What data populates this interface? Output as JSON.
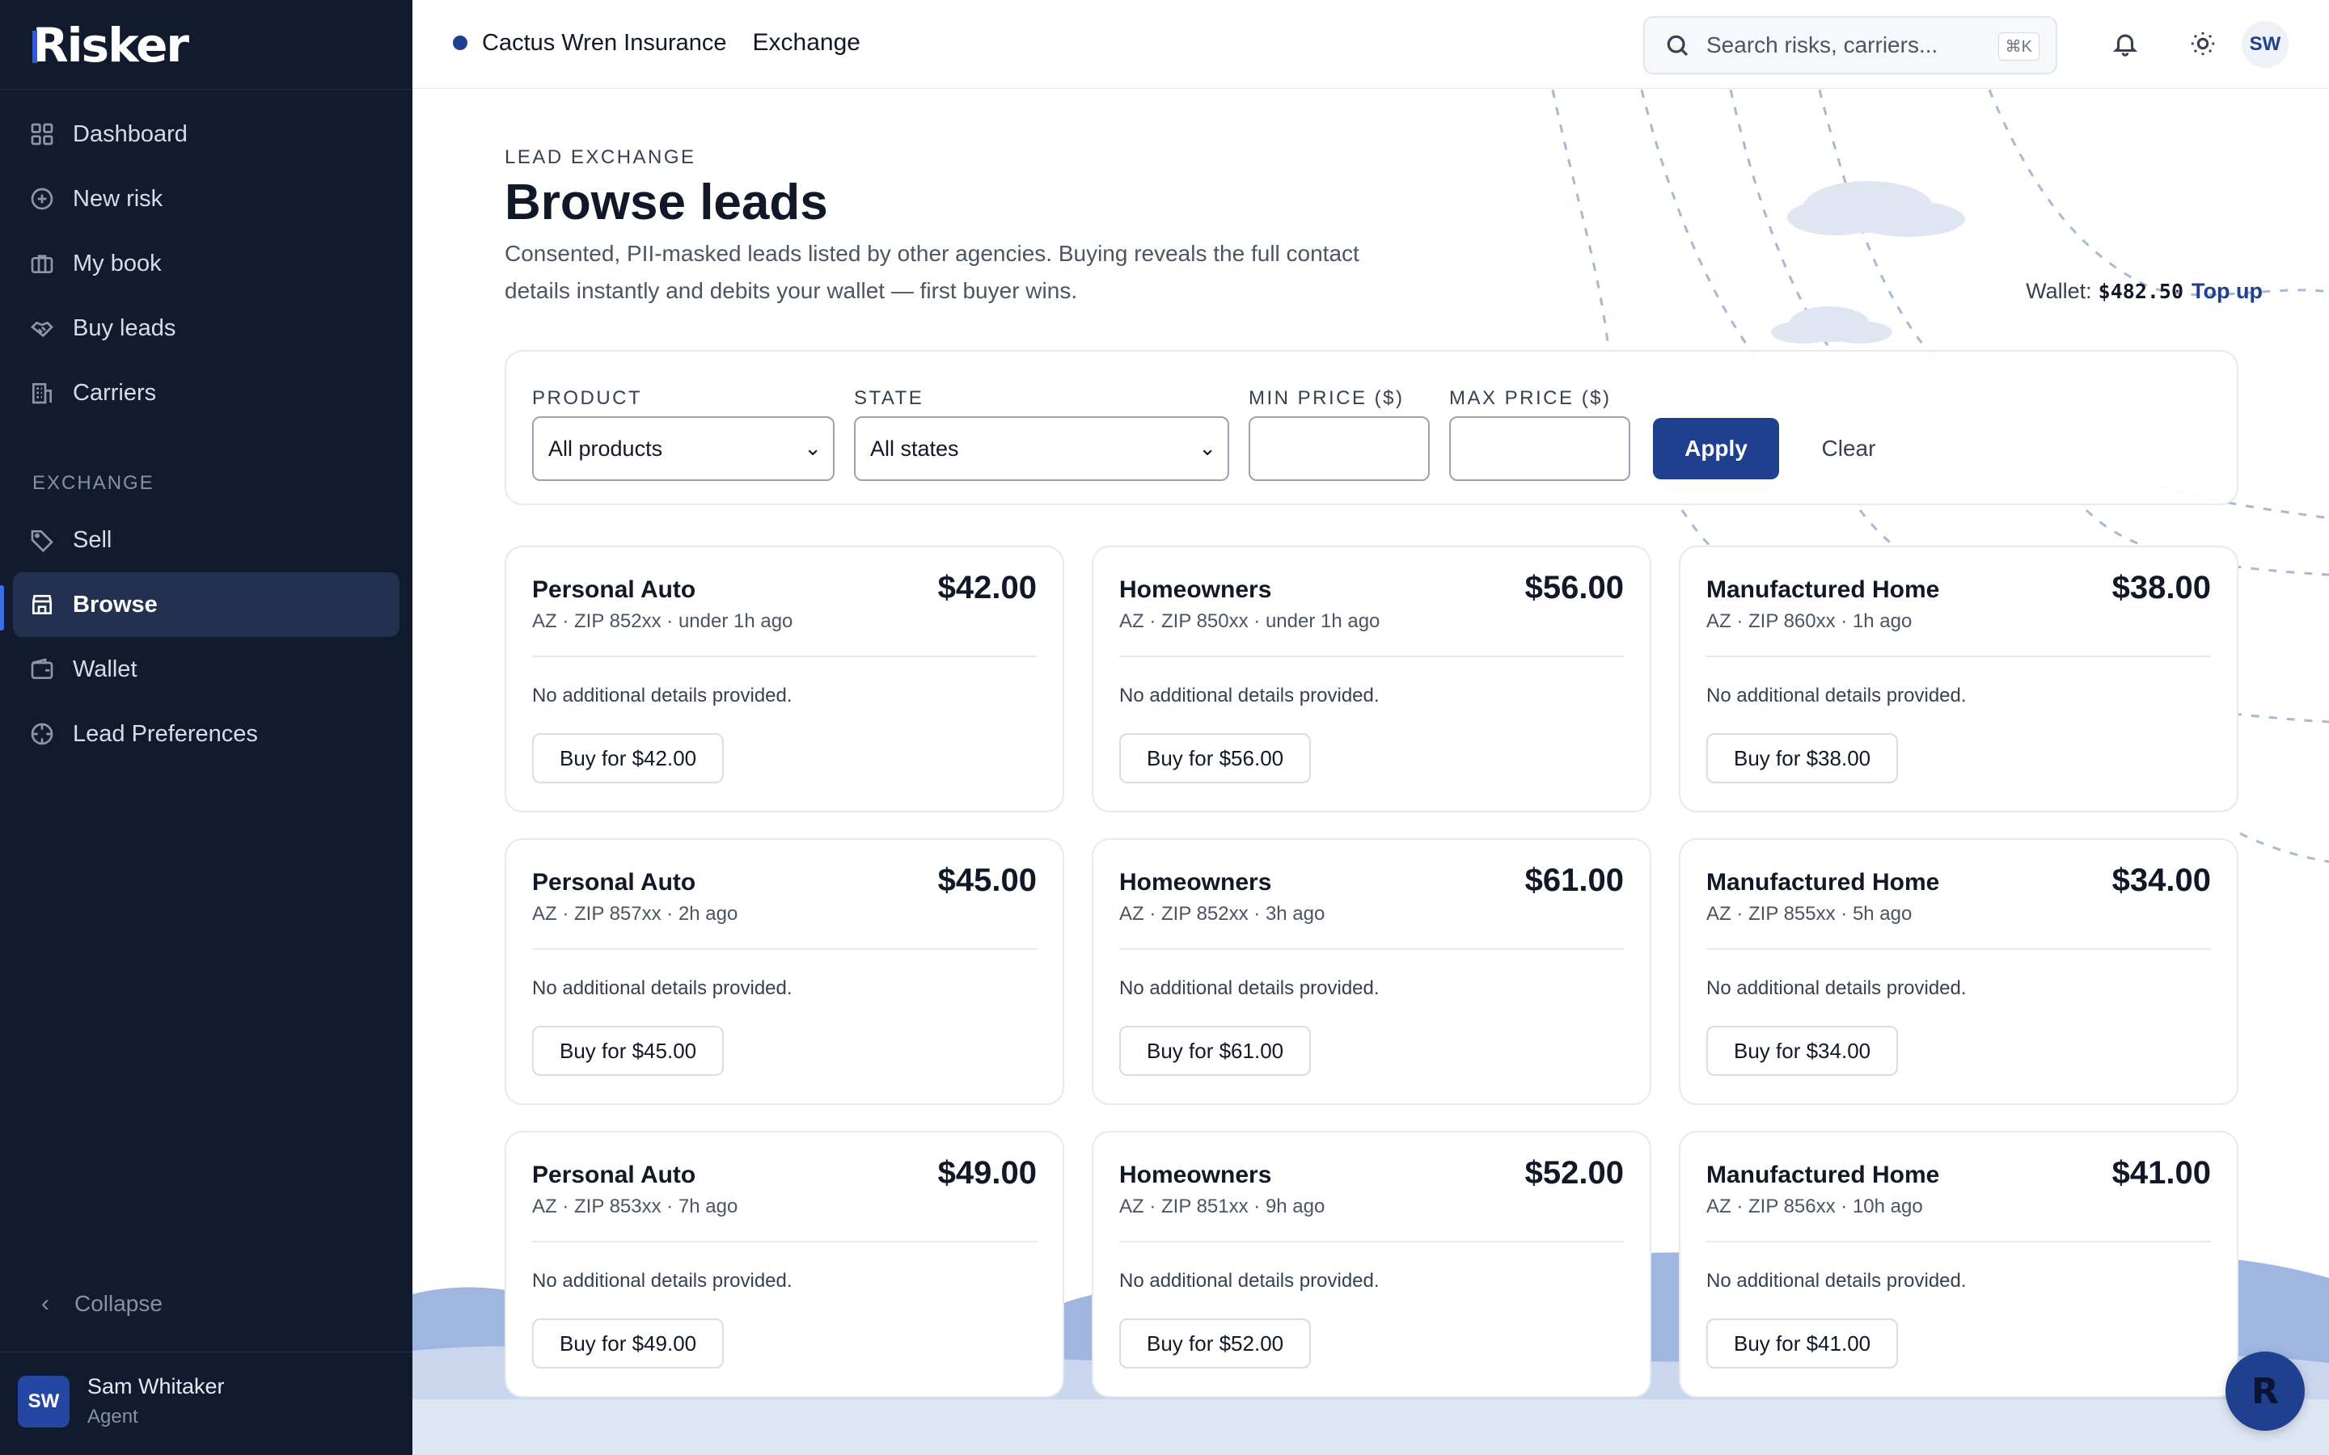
{
  "brand": {
    "name": "Risker"
  },
  "sidebar": {
    "items": [
      {
        "label": "Dashboard",
        "icon": "grid-icon"
      },
      {
        "label": "New risk",
        "icon": "plus-circle-icon"
      },
      {
        "label": "My book",
        "icon": "briefcase-icon"
      },
      {
        "label": "Buy leads",
        "icon": "handshake-icon"
      },
      {
        "label": "Carriers",
        "icon": "building-icon"
      }
    ],
    "section_label": "EXCHANGE",
    "exchange_items": [
      {
        "label": "Sell",
        "icon": "tag-icon"
      },
      {
        "label": "Browse",
        "icon": "store-icon",
        "active": true
      },
      {
        "label": "Wallet",
        "icon": "wallet-icon"
      },
      {
        "label": "Lead Preferences",
        "icon": "target-icon"
      }
    ],
    "collapse_label": "Collapse",
    "user": {
      "initials": "SW",
      "name": "Sam Whitaker",
      "role": "Agent"
    }
  },
  "topbar": {
    "org_name": "Cactus Wren Insurance",
    "section": "Exchange",
    "search_placeholder": "Search risks, carriers...",
    "search_shortcut": "⌘K",
    "avatar_initials": "SW"
  },
  "page": {
    "eyebrow": "LEAD EXCHANGE",
    "title": "Browse leads",
    "description": "Consented, PII-masked leads listed by other agencies. Buying reveals the full contact details instantly and debits your wallet — first buyer wins.",
    "wallet_label": "Wallet:",
    "wallet_amount": "$482.50",
    "top_up_label": "Top up"
  },
  "filters": {
    "product_label": "PRODUCT",
    "product_value": "All products",
    "state_label": "STATE",
    "state_value": "All states",
    "min_price_label": "MIN PRICE ($)",
    "max_price_label": "MAX PRICE ($)",
    "apply_label": "Apply",
    "clear_label": "Clear"
  },
  "leads": [
    {
      "product": "Personal Auto",
      "meta": "AZ · ZIP 852xx · under 1h ago",
      "price": "$42.00",
      "details": "No additional details provided.",
      "buy_label": "Buy for $42.00"
    },
    {
      "product": "Homeowners",
      "meta": "AZ · ZIP 850xx · under 1h ago",
      "price": "$56.00",
      "details": "No additional details provided.",
      "buy_label": "Buy for $56.00"
    },
    {
      "product": "Manufactured Home",
      "meta": "AZ · ZIP 860xx · 1h ago",
      "price": "$38.00",
      "details": "No additional details provided.",
      "buy_label": "Buy for $38.00"
    },
    {
      "product": "Personal Auto",
      "meta": "AZ · ZIP 857xx · 2h ago",
      "price": "$45.00",
      "details": "No additional details provided.",
      "buy_label": "Buy for $45.00"
    },
    {
      "product": "Homeowners",
      "meta": "AZ · ZIP 852xx · 3h ago",
      "price": "$61.00",
      "details": "No additional details provided.",
      "buy_label": "Buy for $61.00"
    },
    {
      "product": "Manufactured Home",
      "meta": "AZ · ZIP 855xx · 5h ago",
      "price": "$34.00",
      "details": "No additional details provided.",
      "buy_label": "Buy for $34.00"
    },
    {
      "product": "Personal Auto",
      "meta": "AZ · ZIP 853xx · 7h ago",
      "price": "$49.00",
      "details": "No additional details provided.",
      "buy_label": "Buy for $49.00"
    },
    {
      "product": "Homeowners",
      "meta": "AZ · ZIP 851xx · 9h ago",
      "price": "$52.00",
      "details": "No additional details provided.",
      "buy_label": "Buy for $52.00"
    },
    {
      "product": "Manufactured Home",
      "meta": "AZ · ZIP 856xx · 10h ago",
      "price": "$41.00",
      "details": "No additional details provided.",
      "buy_label": "Buy for $41.00"
    }
  ],
  "fab": {
    "glyph": "R"
  },
  "colors": {
    "sidebar_bg": "#121a2e",
    "accent": "#1f3f8f",
    "active_bg": "#233150"
  }
}
